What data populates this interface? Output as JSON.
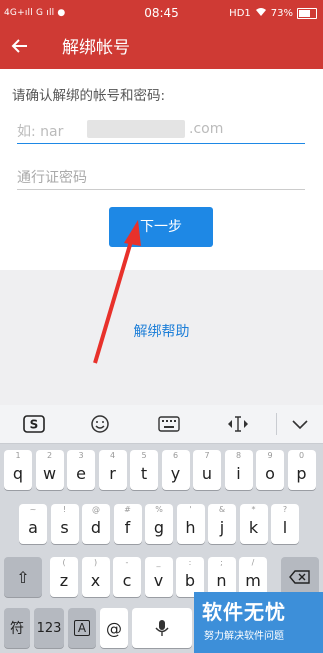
{
  "status": {
    "left": "4G+ıll G ıll ●",
    "time": "08:45",
    "hd": "HD1",
    "battery": "73%"
  },
  "appbar": {
    "title": "解绑帐号"
  },
  "form": {
    "prompt": "请确认解绑的帐号和密码:",
    "account_prefix": "如: nar",
    "account_suffix": ".com",
    "password_placeholder": "通行证密码",
    "next_label": "下一步",
    "help_link": "解绑帮助"
  },
  "keyboard": {
    "toolbar": {
      "sogou": "S",
      "emoji": "☺",
      "keyboard": "⌨",
      "cursor": "‹I›",
      "collapse": "⌄"
    },
    "row1": [
      [
        "1",
        "q"
      ],
      [
        "2",
        "w"
      ],
      [
        "3",
        "e"
      ],
      [
        "4",
        "r"
      ],
      [
        "5",
        "t"
      ],
      [
        "6",
        "y"
      ],
      [
        "7",
        "u"
      ],
      [
        "8",
        "i"
      ],
      [
        "9",
        "o"
      ],
      [
        "0",
        "p"
      ]
    ],
    "row2": [
      [
        "~",
        "a"
      ],
      [
        "!",
        "s"
      ],
      [
        "@",
        "d"
      ],
      [
        "#",
        "f"
      ],
      [
        "%",
        "g"
      ],
      [
        "'",
        "h"
      ],
      [
        "&",
        "j"
      ],
      [
        "*",
        "k"
      ],
      [
        "?",
        "l"
      ]
    ],
    "row3": [
      [
        "(",
        "z"
      ],
      [
        ")",
        "x"
      ],
      [
        "-",
        "c"
      ],
      [
        "_",
        "v"
      ],
      [
        ":",
        "b"
      ],
      [
        ";",
        "n"
      ],
      [
        "/",
        "m"
      ]
    ],
    "shift": "⇧",
    "delete": "⌫",
    "bottom": {
      "sym": "符",
      "num": "123",
      "a_key": "A",
      "at": "@"
    }
  },
  "watermark": {
    "big": "软件无忧",
    "small": "努力解决软件问题"
  },
  "colors": {
    "accent": "#cf3a34",
    "button": "#1e88e5",
    "link": "#1e7fd8"
  }
}
